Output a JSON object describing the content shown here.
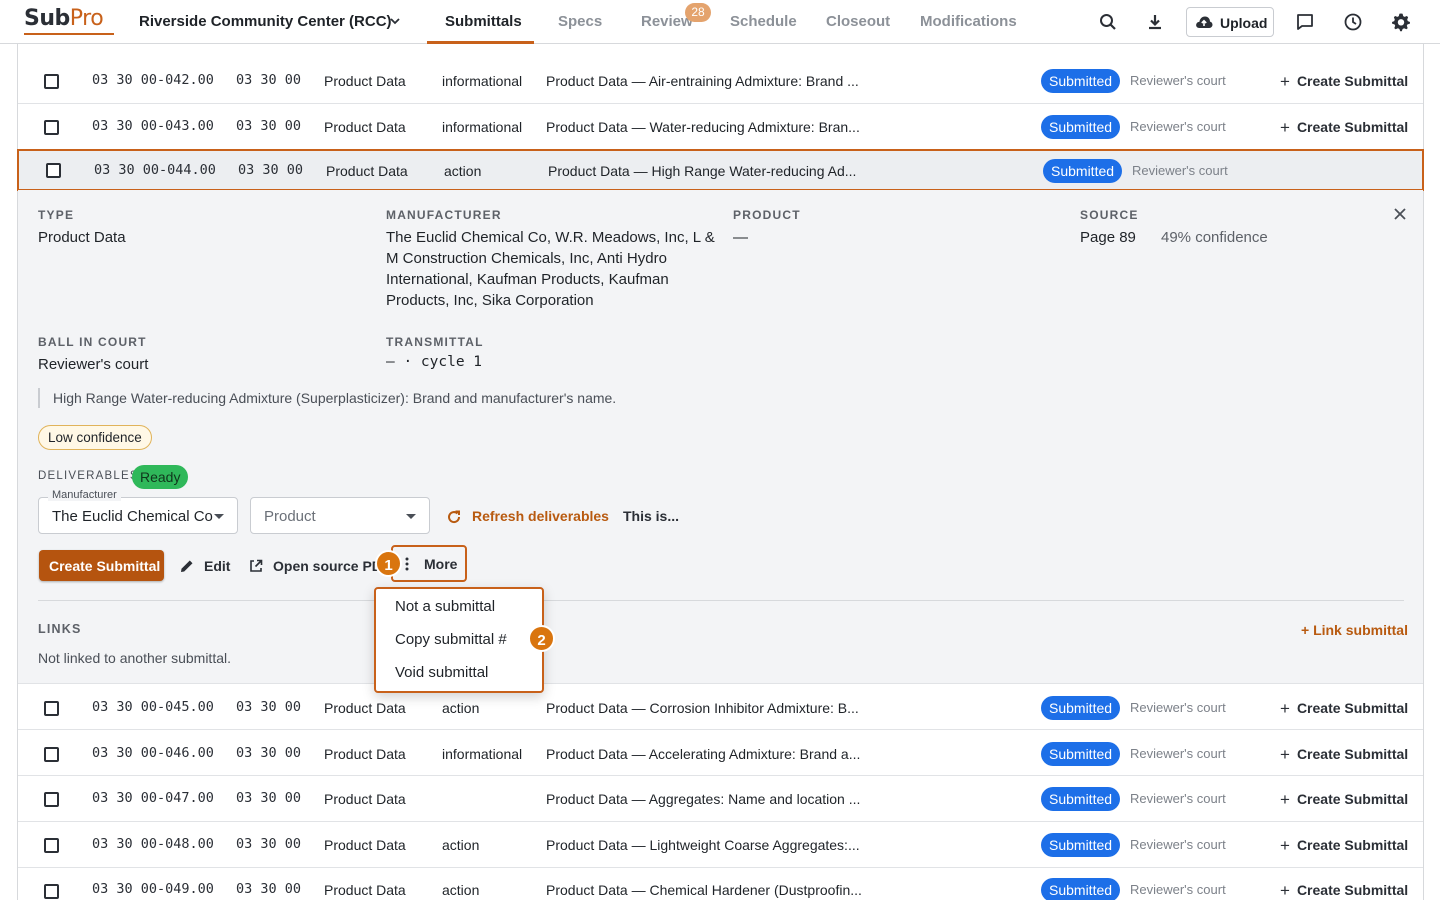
{
  "app": {
    "logo_main": "Sub",
    "logo_accent": "Pro"
  },
  "project": {
    "name": "Riverside Community Center (RCC)"
  },
  "tabs": [
    {
      "label": "Submittals",
      "active": true
    },
    {
      "label": "Specs"
    },
    {
      "label": "Review",
      "badge": "28"
    },
    {
      "label": "Schedule"
    },
    {
      "label": "Closeout"
    },
    {
      "label": "Modifications"
    }
  ],
  "toolbar": {
    "icons": [
      "search-icon",
      "download-icon",
      "upload-cloud-icon",
      "comment-icon",
      "history-icon",
      "gear-icon"
    ],
    "upload_label": "Upload"
  },
  "rows_top": [
    {
      "number": "03 30 00-042.00",
      "section": "03 30 00",
      "type": "Product Data",
      "kind": "informational",
      "title": "Product Data — Air-entraining Admixture: Brand ...",
      "status": "Submitted",
      "court": "Reviewer's court",
      "create": "Create Submittal"
    },
    {
      "number": "03 30 00-043.00",
      "section": "03 30 00",
      "type": "Product Data",
      "kind": "informational",
      "title": "Product Data — Water-reducing Admixture: Bran...",
      "status": "Submitted",
      "court": "Reviewer's court",
      "create": "Create Submittal"
    }
  ],
  "selected_row": {
    "number": "03 30 00-044.00",
    "section": "03 30 00",
    "type": "Product Data",
    "kind": "action",
    "title": "Product Data — High Range Water-reducing Ad...",
    "status": "Submitted",
    "court": "Reviewer's court"
  },
  "detail": {
    "type_label": "TYPE",
    "type_value": "Product Data",
    "manufacturer_label": "MANUFACTURER",
    "manufacturer_lines": [
      "The Euclid Chemical Co, W.R. Meadows, Inc, L &",
      "M Construction Chemicals, Inc, Anti Hydro",
      "International, Kaufman Products, Kaufman",
      "Products, Inc, Sika Corporation"
    ],
    "product_label": "PRODUCT",
    "product_value": "—",
    "source_label": "SOURCE",
    "source_page": "Page 89",
    "source_confidence": "49% confidence",
    "ball_label": "BALL IN COURT",
    "ball_value": "Reviewer's court",
    "transmittal_label": "TRANSMITTAL",
    "transmittal_value": "— · cycle 1",
    "description": "High Range Water-reducing Admixture (Superplasticizer): Brand and manufacturer's name.",
    "confidence_badge": "Low confidence",
    "deliverables_label": "DELIVERABLES",
    "deliverables_status": "Ready",
    "manufacturer_select_legend": "Manufacturer",
    "manufacturer_select_value": "The Euclid Chemical Co",
    "product_select_placeholder": "Product",
    "refresh_label": "Refresh deliverables",
    "this_is_label": "This is...",
    "create_button": "Create Submittal",
    "edit_label": "Edit",
    "open_source_label": "Open source PDF",
    "more_label": "More",
    "links_label": "LINKS",
    "link_submittal": "+ Link submittal",
    "not_linked": "Not linked to another submittal."
  },
  "annotations": {
    "more_marker": "1",
    "copy_marker": "2"
  },
  "more_menu": [
    {
      "label": "Not a submittal"
    },
    {
      "label": "Copy submittal #"
    },
    {
      "label": "Void submittal"
    }
  ],
  "rows_bottom": [
    {
      "number": "03 30 00-045.00",
      "section": "03 30 00",
      "type": "Product Data",
      "kind": "action",
      "title": "Product Data — Corrosion Inhibitor Admixture: B...",
      "status": "Submitted",
      "court": "Reviewer's court",
      "create": "Create Submittal"
    },
    {
      "number": "03 30 00-046.00",
      "section": "03 30 00",
      "type": "Product Data",
      "kind": "informational",
      "title": "Product Data — Accelerating Admixture: Brand a...",
      "status": "Submitted",
      "court": "Reviewer's court",
      "create": "Create Submittal"
    },
    {
      "number": "03 30 00-047.00",
      "section": "03 30 00",
      "type": "Product Data",
      "kind": "",
      "title": "Product Data — Aggregates: Name and location ...",
      "status": "Submitted",
      "court": "Reviewer's court",
      "create": "Create Submittal"
    },
    {
      "number": "03 30 00-048.00",
      "section": "03 30 00",
      "type": "Product Data",
      "kind": "action",
      "title": "Product Data — Lightweight Coarse Aggregates:...",
      "status": "Submitted",
      "court": "Reviewer's court",
      "create": "Create Submittal"
    },
    {
      "number": "03 30 00-049.00",
      "section": "03 30 00",
      "type": "Product Data",
      "kind": "action",
      "title": "Product Data — Chemical Hardener (Dustproofin...",
      "status": "Submitted",
      "court": "Reviewer's court",
      "create": "Create Submittal"
    }
  ],
  "colors": {
    "accent": "#c8611a",
    "status_blue": "#1d6fe8",
    "ready_green": "#2fb85a"
  }
}
